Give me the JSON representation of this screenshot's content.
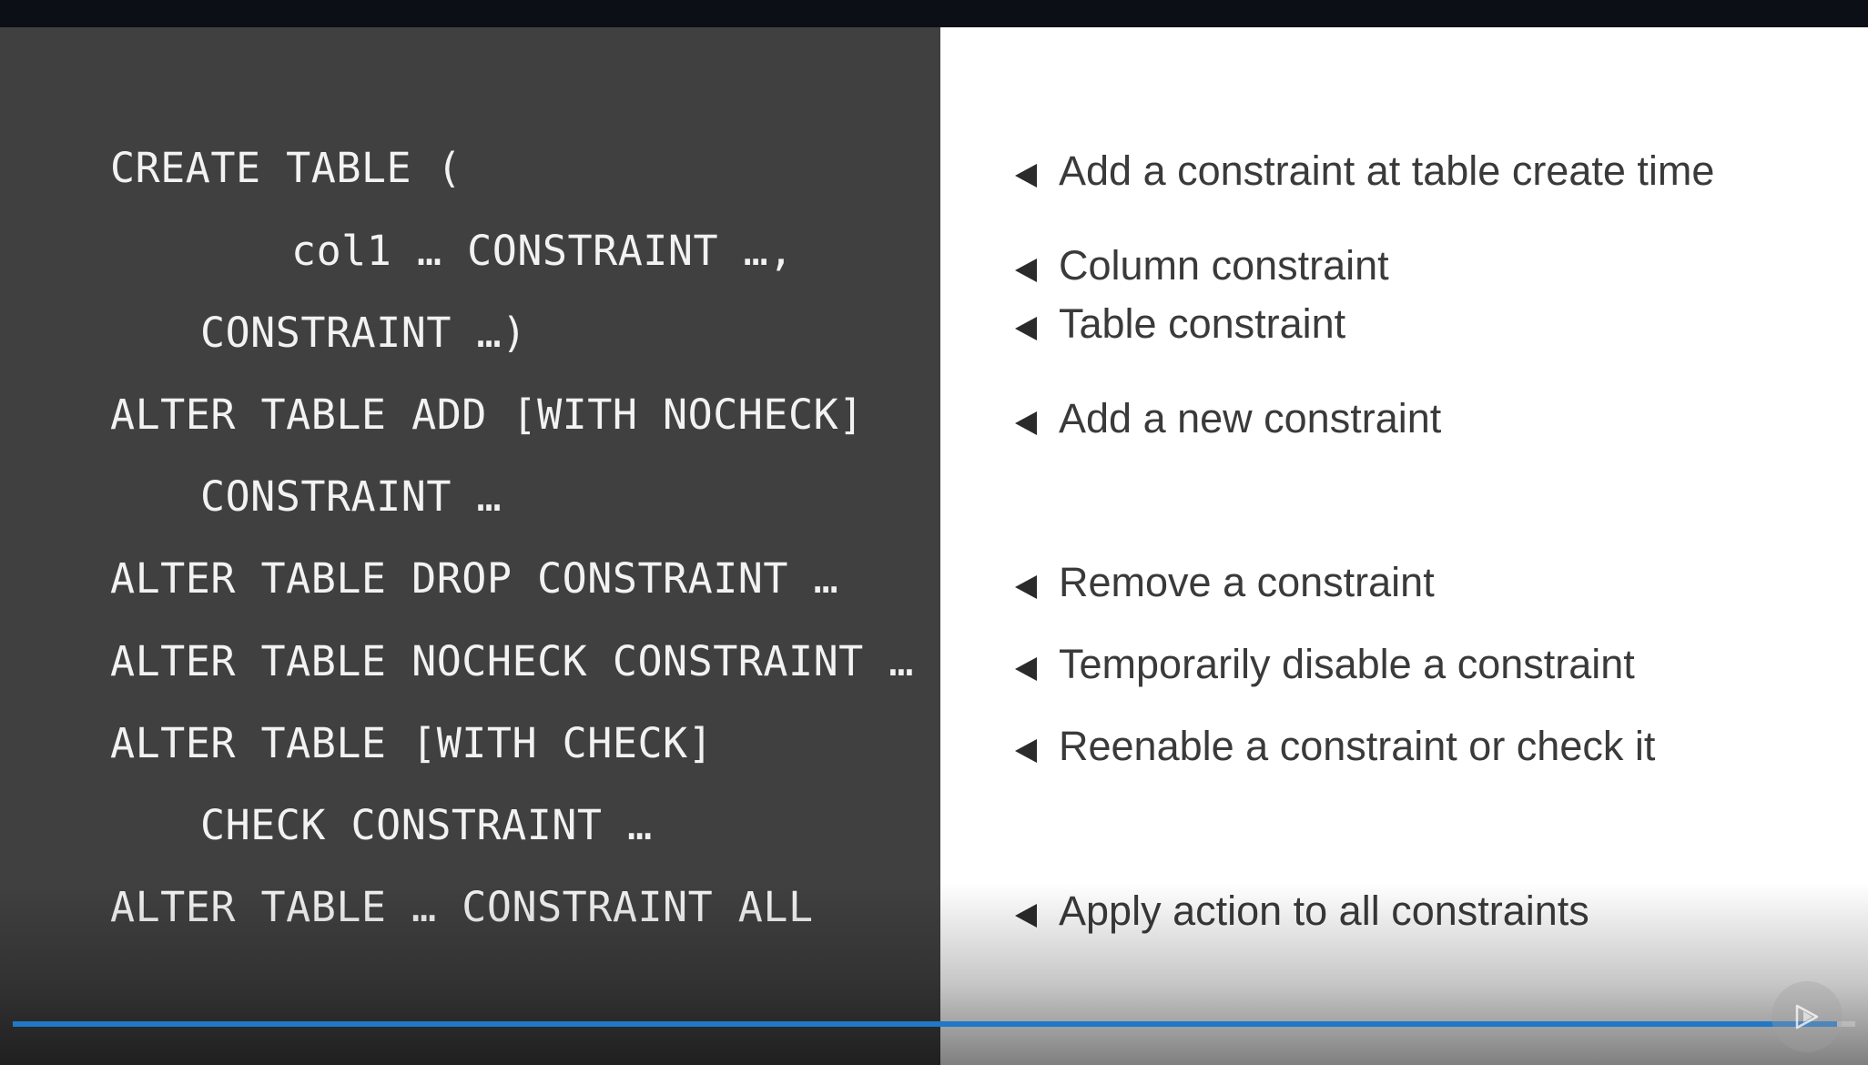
{
  "slide": {
    "code_lines": [
      "CREATE TABLE (",
      "col1 … CONSTRAINT …,",
      "CONSTRAINT …)",
      "ALTER TABLE ADD [WITH NOCHECK]",
      "CONSTRAINT …",
      "ALTER TABLE DROP CONSTRAINT …",
      "ALTER TABLE NOCHECK CONSTRAINT …",
      "ALTER TABLE [WITH CHECK]",
      "CHECK CONSTRAINT …",
      "ALTER TABLE … CONSTRAINT ALL"
    ],
    "descriptions": [
      "Add a constraint at table create time",
      "Column constraint",
      "Table constraint",
      "Add a new constraint",
      "Remove a constraint",
      "Temporarily disable a constraint",
      "Reenable a constraint or check it",
      "Apply action to all constraints"
    ]
  },
  "player": {
    "progress_fraction": 0.99,
    "accent_color": "#1f78c8",
    "play_icon": "play-icon"
  },
  "colors": {
    "left_panel": "#404040",
    "right_panel": "#ffffff",
    "code_text": "#f2f2f2",
    "description_text": "#3a3a3a"
  }
}
